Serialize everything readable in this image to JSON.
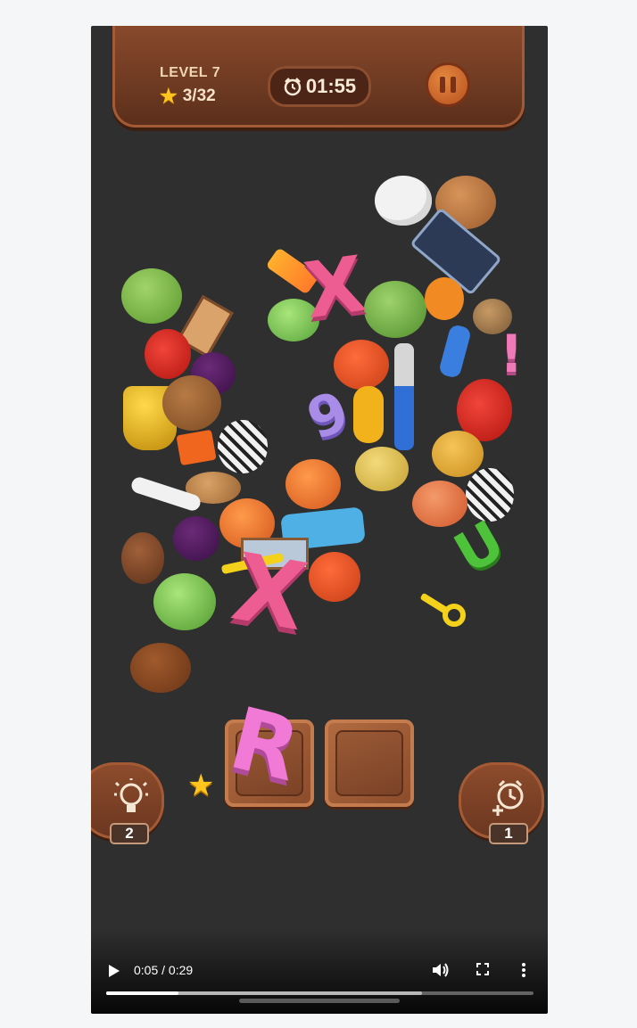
{
  "hud": {
    "level_label": "LEVEL 7",
    "stars_progress": "3/32",
    "timer": "01:55"
  },
  "pile": {
    "letters": [
      "X",
      "9",
      "U",
      "!",
      "X",
      "R"
    ]
  },
  "tray": {
    "slot_1_item": "R",
    "slot_2_item": ""
  },
  "powerups": {
    "hint_count": "2",
    "add_time_count": "1"
  },
  "video": {
    "time": "0:05 / 0:29",
    "played_fraction": 0.17,
    "buffered_fraction": 0.74
  },
  "colors": {
    "board": "#2f2f2f",
    "wood": "#7a4126",
    "pink_letter": "#ee5d92",
    "star": "#ffc51e"
  }
}
